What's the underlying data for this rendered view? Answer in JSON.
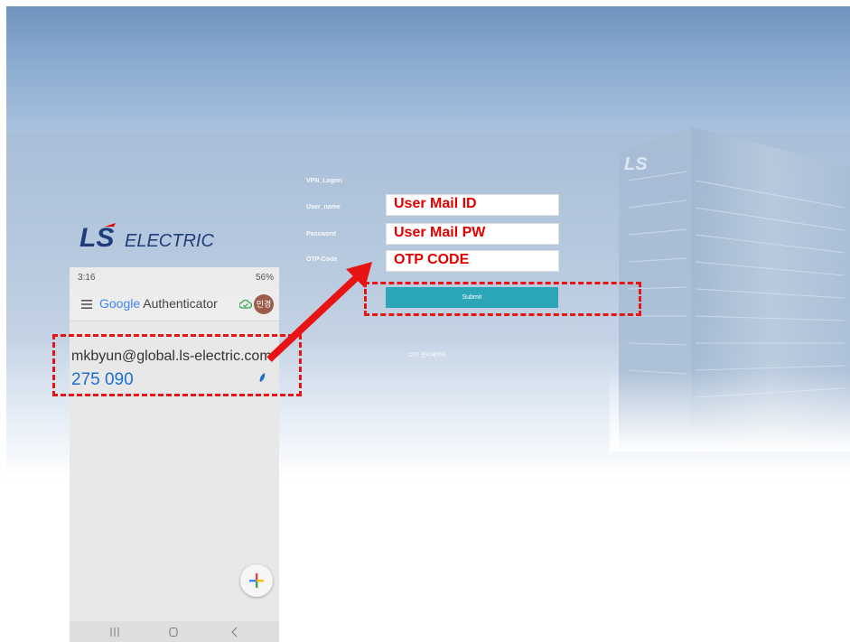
{
  "login_form": {
    "heading": "VPN_Logon",
    "username_label": "User_name",
    "password_label": "Password",
    "otp_label": "OTP-Code",
    "submit_label": "Submit",
    "otp_management_link": "OTP 관리페이지"
  },
  "annotations": {
    "user_id": "User Mail ID",
    "user_pw": "User Mail PW",
    "otp_code": "OTP CODE"
  },
  "brand": {
    "logo_text_ls": "LS",
    "logo_text_electric": "ELECTRIC",
    "building_sign": "LS"
  },
  "phone": {
    "status_time": "3:16",
    "status_right": "56%",
    "app_title_google": "Google",
    "app_title_rest": "Authenticator",
    "avatar_text": "민경",
    "account_email": "mkbyun@global.ls-electric.com",
    "otp_code": "275 090"
  },
  "colors": {
    "submit_button": "#2aa6b8",
    "annotation_red": "#e30000",
    "code_blue": "#1a6fd0",
    "logo_navy": "#1f3d7a"
  },
  "icons": [
    "menu-icon",
    "cloud-check-icon",
    "timer-icon",
    "add-icon",
    "recent-apps-icon",
    "home-icon",
    "back-icon",
    "arrow-annotation"
  ]
}
